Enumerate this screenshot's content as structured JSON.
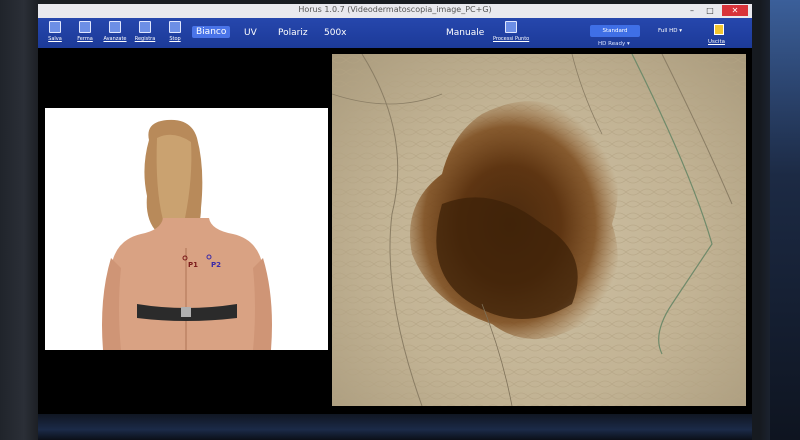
{
  "window": {
    "title": "Horus 1.0.7 (Videodermatoscopia_image_PC+G)",
    "controls": {
      "minimize": "–",
      "maximize": "□",
      "close": "✕"
    }
  },
  "toolbar": {
    "tools": [
      {
        "label": "Salva",
        "icon": "save-icon"
      },
      {
        "label": "Ferma",
        "icon": "stop-icon"
      },
      {
        "label": "Avanzate",
        "icon": "advanced-icon"
      },
      {
        "label": "Registra",
        "icon": "record-icon"
      },
      {
        "label": "Stop",
        "icon": "stop-square-icon"
      }
    ],
    "modes": [
      "Bianco",
      "UV",
      "Polariz",
      "500x"
    ],
    "active_mode": "Bianco",
    "manual_label": "Manuale",
    "process_points_label": "Processi Punto",
    "standard_button": "Standard",
    "hd_ready_label": "HD Ready",
    "fullhd_label": "Full HD",
    "exit_label": "Uscita"
  },
  "body_map": {
    "points": [
      {
        "label": "P1",
        "color": "#7a1a1a"
      },
      {
        "label": "P2",
        "color": "#3a2aa8"
      }
    ]
  },
  "colors": {
    "toolbar": "#1e3fa0",
    "active_mode": "#4a74e8",
    "close_button": "#d8333a",
    "lesion_dark": "#4a2a0e"
  }
}
